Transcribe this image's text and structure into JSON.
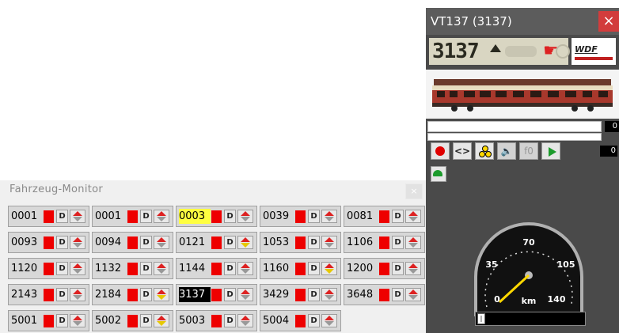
{
  "monitor": {
    "title": "Fahrzeug-Monitor",
    "rows": [
      [
        "0001",
        "0001",
        "0003",
        "0039",
        "0081"
      ],
      [
        "0093",
        "0094",
        "0121",
        "1053",
        "1106"
      ],
      [
        "1120",
        "1132",
        "1144",
        "1160",
        "1200"
      ],
      [
        "2143",
        "2184",
        "3137",
        "3429",
        "3648"
      ],
      [
        "5001",
        "5002",
        "5003",
        "5004"
      ]
    ],
    "highlighted": "0003",
    "selected": "3137",
    "dbox_label": "D"
  },
  "panel": {
    "title": "VT137   (3137)",
    "close_glyph": "×",
    "lcd_number": "3137",
    "brand": "WDF",
    "value1": "0",
    "value2": "0",
    "fn_label": "f0",
    "nav_label": "<>",
    "speed_unit": "km",
    "gauge_ticks": [
      "0",
      "35",
      "70",
      "105",
      "140"
    ],
    "speed_value": 0
  },
  "colors": {
    "accent_red": "#e00000",
    "highlight_yellow": "#ffff40",
    "panel_bg": "#4a4a4a",
    "needle": "#ffd800"
  }
}
